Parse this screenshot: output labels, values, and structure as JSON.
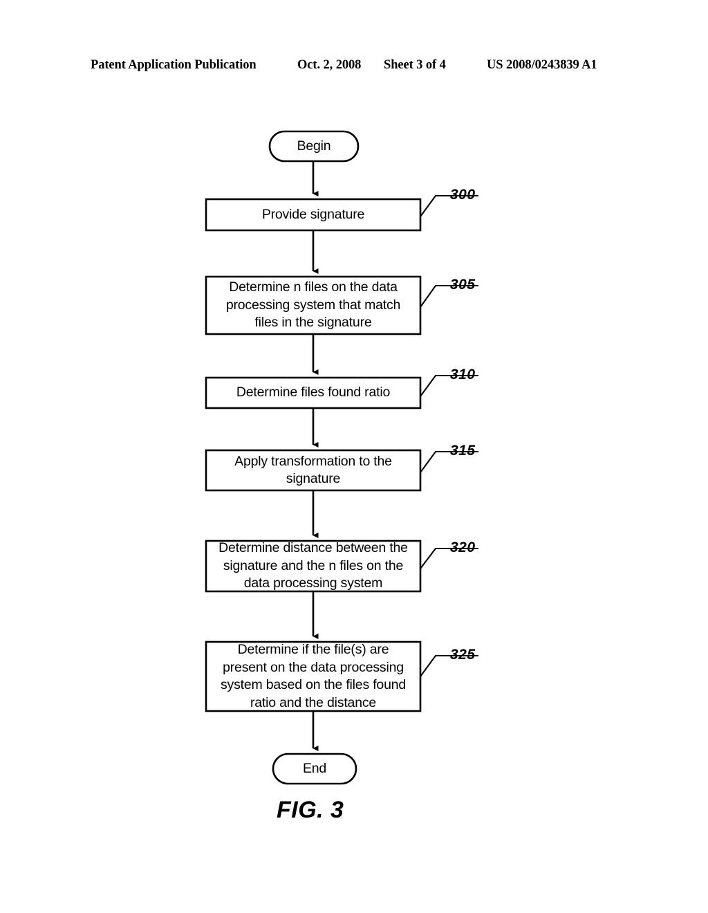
{
  "header": {
    "publication": "Patent Application Publication",
    "date": "Oct. 2, 2008",
    "sheet": "Sheet 3 of 4",
    "patent_number": "US 2008/0243839 A1"
  },
  "figure": {
    "caption": "FIG. 3",
    "type": "flowchart",
    "start_terminal": "Begin",
    "end_terminal": "End",
    "steps": [
      {
        "ref": "300",
        "label": "Provide signature",
        "lines": 1
      },
      {
        "ref": "305",
        "label": "Determine n files on the data\nprocessing system that match\nfiles in the signature",
        "lines": 3
      },
      {
        "ref": "310",
        "label": "Determine files found ratio",
        "lines": 1
      },
      {
        "ref": "315",
        "label": "Apply transformation to the\nsignature",
        "lines": 2
      },
      {
        "ref": "320",
        "label": "Determine distance between the\nsignature and the n files on the\ndata processing system",
        "lines": 3
      },
      {
        "ref": "325",
        "label": "Determine if the file(s) are\npresent on the data processing\nsystem based on the files found\nratio and the distance",
        "lines": 4
      }
    ]
  },
  "colors": {
    "ink": "#000000",
    "paper": "#ffffff"
  }
}
